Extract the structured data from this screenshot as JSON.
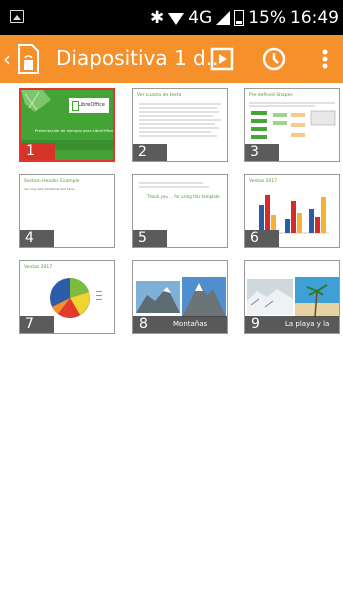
{
  "status_bar": {
    "network": "4G",
    "battery": "15%",
    "time": "16:49"
  },
  "toolbar": {
    "title": "Diapositiva 1 d.."
  },
  "slides": [
    {
      "number": "1",
      "title": "",
      "body": "Presentación de ejemplo para LibreOffice",
      "logo": "LibreOffice"
    },
    {
      "number": "2",
      "title": "Ver cuadro de texto",
      "body": ""
    },
    {
      "number": "3",
      "title": "Pre-defined Shapes",
      "body": ""
    },
    {
      "number": "4",
      "title": "Section Header Example",
      "body": "You may add additional text here..."
    },
    {
      "number": "5",
      "title": "",
      "body": "Thank you ... for using this template"
    },
    {
      "number": "6",
      "title": "Ventas 2017",
      "body": ""
    },
    {
      "number": "7",
      "title": "Ventas 2017",
      "body": ""
    },
    {
      "number": "8",
      "title": "",
      "body": "",
      "caption": "Montañas"
    },
    {
      "number": "9",
      "title": "",
      "body": "",
      "caption": "La playa y la nieve"
    }
  ]
}
